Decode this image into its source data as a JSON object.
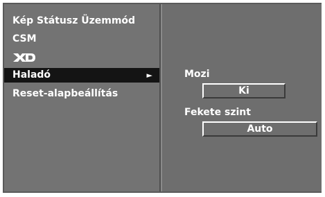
{
  "menu": {
    "items": [
      {
        "label": "Kép Státusz Üzemmód"
      },
      {
        "label": "CSM"
      },
      {
        "label": "XD"
      },
      {
        "label": "Haladó",
        "arrow": "►"
      },
      {
        "label": "Reset-alapbeállítás"
      }
    ],
    "selected_index": 3
  },
  "submenu": {
    "mozi_label": "Mozi",
    "mozi_value": "Ki",
    "black_level_label": "Fekete szint",
    "black_level_value": "Auto"
  }
}
